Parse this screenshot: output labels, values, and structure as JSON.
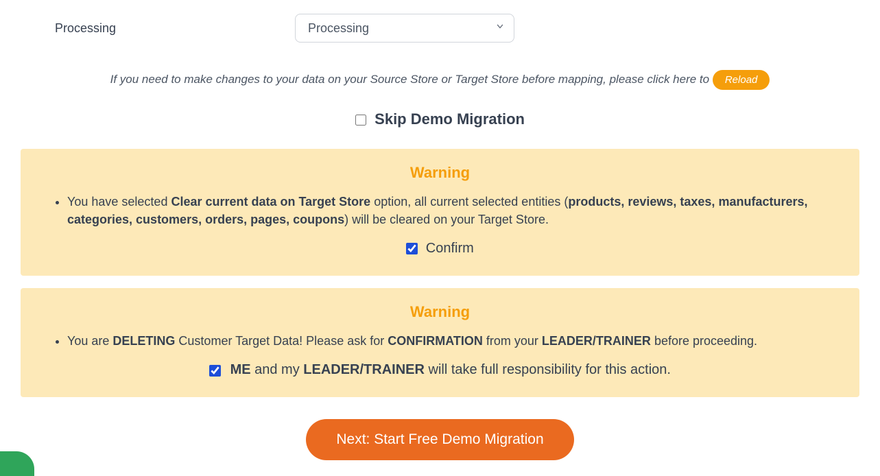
{
  "mapping": {
    "label": "Processing",
    "selected": "Processing"
  },
  "hint": {
    "text": "If you need to make changes to your data on your Source Store or Target Store before mapping, please click here to ",
    "reload": "Reload"
  },
  "skip": {
    "label": "Skip Demo Migration"
  },
  "warning1": {
    "title": "Warning",
    "pre": "You have selected ",
    "bold1": "Clear current data on Target Store",
    "mid": " option, all current selected entities (",
    "bold2": "products, reviews, taxes, manufacturers, categories, customers, orders, pages, coupons",
    "post": ") will be cleared on your Target Store.",
    "confirm": "Confirm"
  },
  "warning2": {
    "title": "Warning",
    "pre": "You are ",
    "b1": "DELETING",
    "mid1": " Customer Target Data! Please ask for ",
    "b2": "CONFIRMATION",
    "mid2": " from your ",
    "b3": "LEADER/TRAINER",
    "post": " before proceeding.",
    "resp_b1": "ME",
    "resp_mid": " and my ",
    "resp_b2": "LEADER/TRAINER",
    "resp_post": " will take full responsibility for this action."
  },
  "next": "Next: Start Free Demo Migration"
}
